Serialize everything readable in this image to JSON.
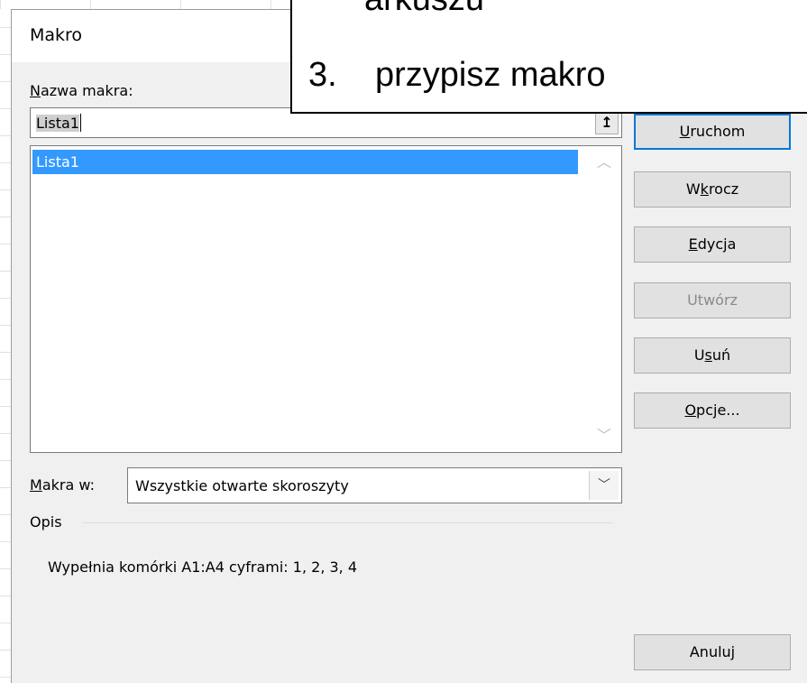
{
  "dialog": {
    "title": "Makro",
    "name_label_prefix": "N",
    "name_label_rest": "azwa makra:",
    "name_value": "Lista1",
    "collapse_icon": "↥",
    "list": {
      "items": [
        "Lista1"
      ]
    },
    "buttons": {
      "run": {
        "pre": "",
        "u": "U",
        "post": "ruchom"
      },
      "step_into": {
        "pre": "W",
        "u": "k",
        "post": "rocz"
      },
      "edit": {
        "pre": "",
        "u": "E",
        "post": "dycja"
      },
      "create": {
        "pre": "",
        "u": "",
        "post": "Utwórz"
      },
      "delete": {
        "pre": "U",
        "u": "s",
        "post": "uń"
      },
      "options": {
        "pre": "",
        "u": "O",
        "post": "pcje..."
      },
      "cancel": {
        "pre": "",
        "u": "",
        "post": "Anuluj"
      }
    },
    "macros_in_label_prefix": "M",
    "macros_in_label_rest": "akra w:",
    "macros_in_value": "Wszystkie otwarte skoroszyty",
    "description_label": "Opis",
    "description_text": "Wypełnia komórki A1:A4 cyframi: 1, 2, 3, 4"
  },
  "overlay": {
    "previous_line_fragment": "arkuszu",
    "step_number": "3.",
    "step_text": "przypisz makro"
  },
  "colors": {
    "selection": "#3399ff",
    "default_button_border": "#0078d7",
    "dialog_bg": "#f0f0f0"
  }
}
